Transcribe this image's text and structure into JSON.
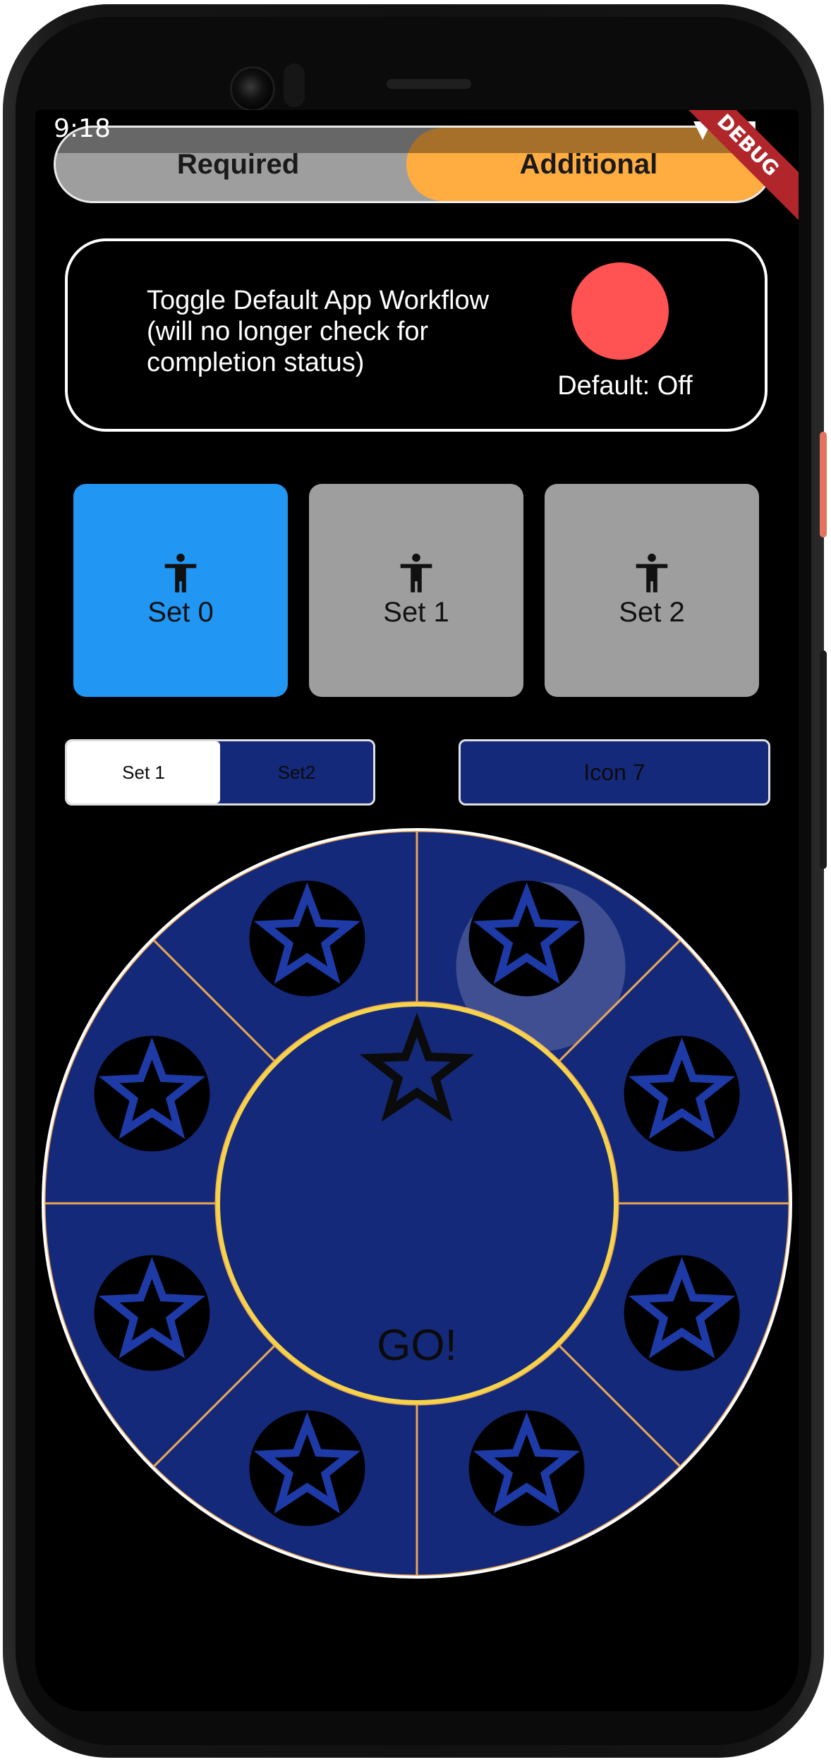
{
  "status_bar": {
    "time": "9:18",
    "debug_banner": "DEBUG"
  },
  "tabs": [
    {
      "label": "Required",
      "selected": false
    },
    {
      "label": "Additional",
      "selected": true
    }
  ],
  "workflow": {
    "text": "Toggle Default App Workflow\n(will no longer check for\ncompletion status)",
    "status": "Default: Off",
    "indicator_color": "#ff5252"
  },
  "sets": [
    {
      "label": "Set 0",
      "selected": true,
      "icon": "accessibility-icon"
    },
    {
      "label": "Set 1",
      "selected": false,
      "icon": "accessibility-icon"
    },
    {
      "label": "Set 2",
      "selected": false,
      "icon": "accessibility-icon"
    }
  ],
  "set_toggle": {
    "options": [
      "Set 1",
      "Set2"
    ],
    "selected": "Set 1"
  },
  "icon_button": {
    "label": "Icon 7"
  },
  "wheel": {
    "center_label": "GO!",
    "center_icon": "star-icon",
    "segment_icon": "star-icon",
    "segment_count": 8
  },
  "colors": {
    "accent_orange": "#ffac41",
    "selected_blue": "#2196f3",
    "tile_grey": "#9e9e9e",
    "navy": "#15297a",
    "gold_ring": "#f6d34a",
    "divider": "#e8a657"
  }
}
